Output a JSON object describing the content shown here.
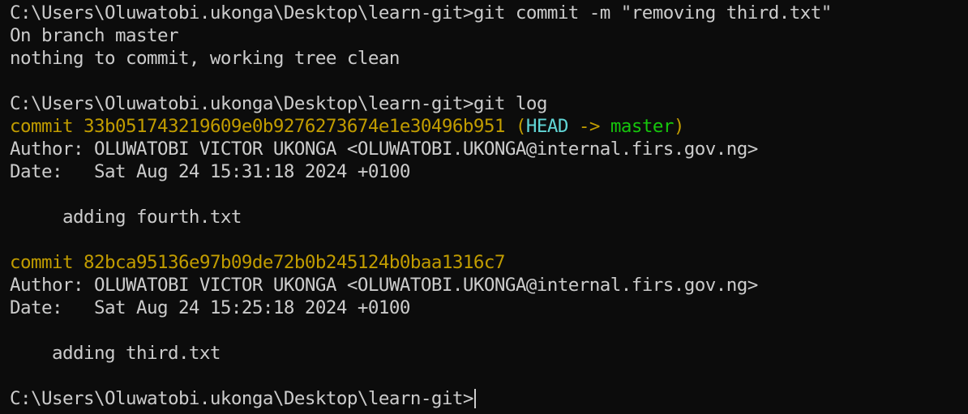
{
  "terminal": {
    "prompt": "C:\\Users\\Oluwatobi.ukonga\\Desktop\\learn-git>",
    "command_commit": "git commit -m \"removing third.txt\"",
    "status_branch": "On branch master",
    "status_clean": "nothing to commit, working tree clean",
    "command_log": "git log",
    "commits": [
      {
        "commit_label": "commit ",
        "hash": "33b051743219609e0b9276273674e1e30496b951",
        "ref_open": " (",
        "head": "HEAD",
        "arrow": " -> ",
        "branch": "master",
        "ref_close": ")",
        "author_line": "Author: OLUWATOBI VICTOR UKONGA <OLUWATOBI.UKONGA@internal.firs.gov.ng>",
        "date_line": "Date:   Sat Aug 24 15:31:18 2024 +0100",
        "message": "     adding fourth.txt"
      },
      {
        "commit_label": "commit ",
        "hash": "82bca95136e97b09de72b0b245124b0baa1316c7",
        "author_line": "Author: OLUWATOBI VICTOR UKONGA <OLUWATOBI.UKONGA@internal.firs.gov.ng>",
        "date_line": "Date:   Sat Aug 24 15:25:18 2024 +0100",
        "message": "    adding third.txt"
      }
    ]
  },
  "colors": {
    "background": "#0c0c0c",
    "text": "#cccccc",
    "commit_hash": "#c19c00",
    "head_ref": "#61d6d6",
    "branch_ref": "#16c60c"
  }
}
